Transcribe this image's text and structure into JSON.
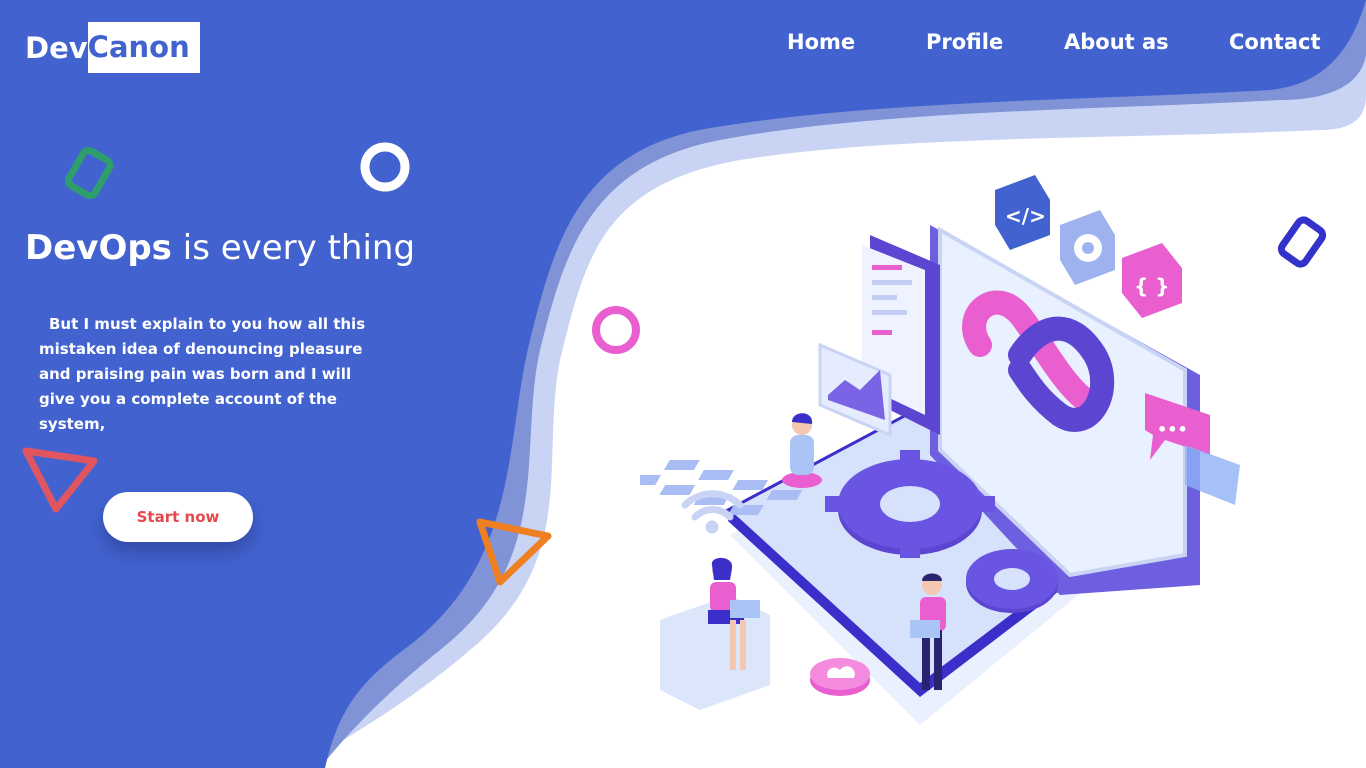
{
  "brand": {
    "part1": "Dev",
    "part2": "Canon"
  },
  "nav": [
    {
      "label": "Home"
    },
    {
      "label": "Profile"
    },
    {
      "label": "About as"
    },
    {
      "label": "Contact"
    }
  ],
  "hero": {
    "headline_bold": "DevOps",
    "headline_rest": " is every thing",
    "description": "But I must explain to you how all this mistaken idea of denouncing pleasure and praising pain was born and I will give you a complete account of the system,",
    "cta_label": "Start now"
  },
  "illustration": {
    "code_icon_text": "</>",
    "brace_icon_text": "{ }",
    "chat_icon_text": "•••"
  },
  "colors": {
    "primary_blue": "#4263cf",
    "wave_mid": "#7f93d6",
    "wave_light": "#c9d4f5",
    "cta_text": "#e5484d",
    "accent_pink": "#e95fcf",
    "accent_purple": "#5c45d0",
    "shape_green": "#2e9e6c",
    "shape_red": "#e0555f",
    "shape_orange": "#ee7f22",
    "shape_navy": "#3333cc"
  }
}
